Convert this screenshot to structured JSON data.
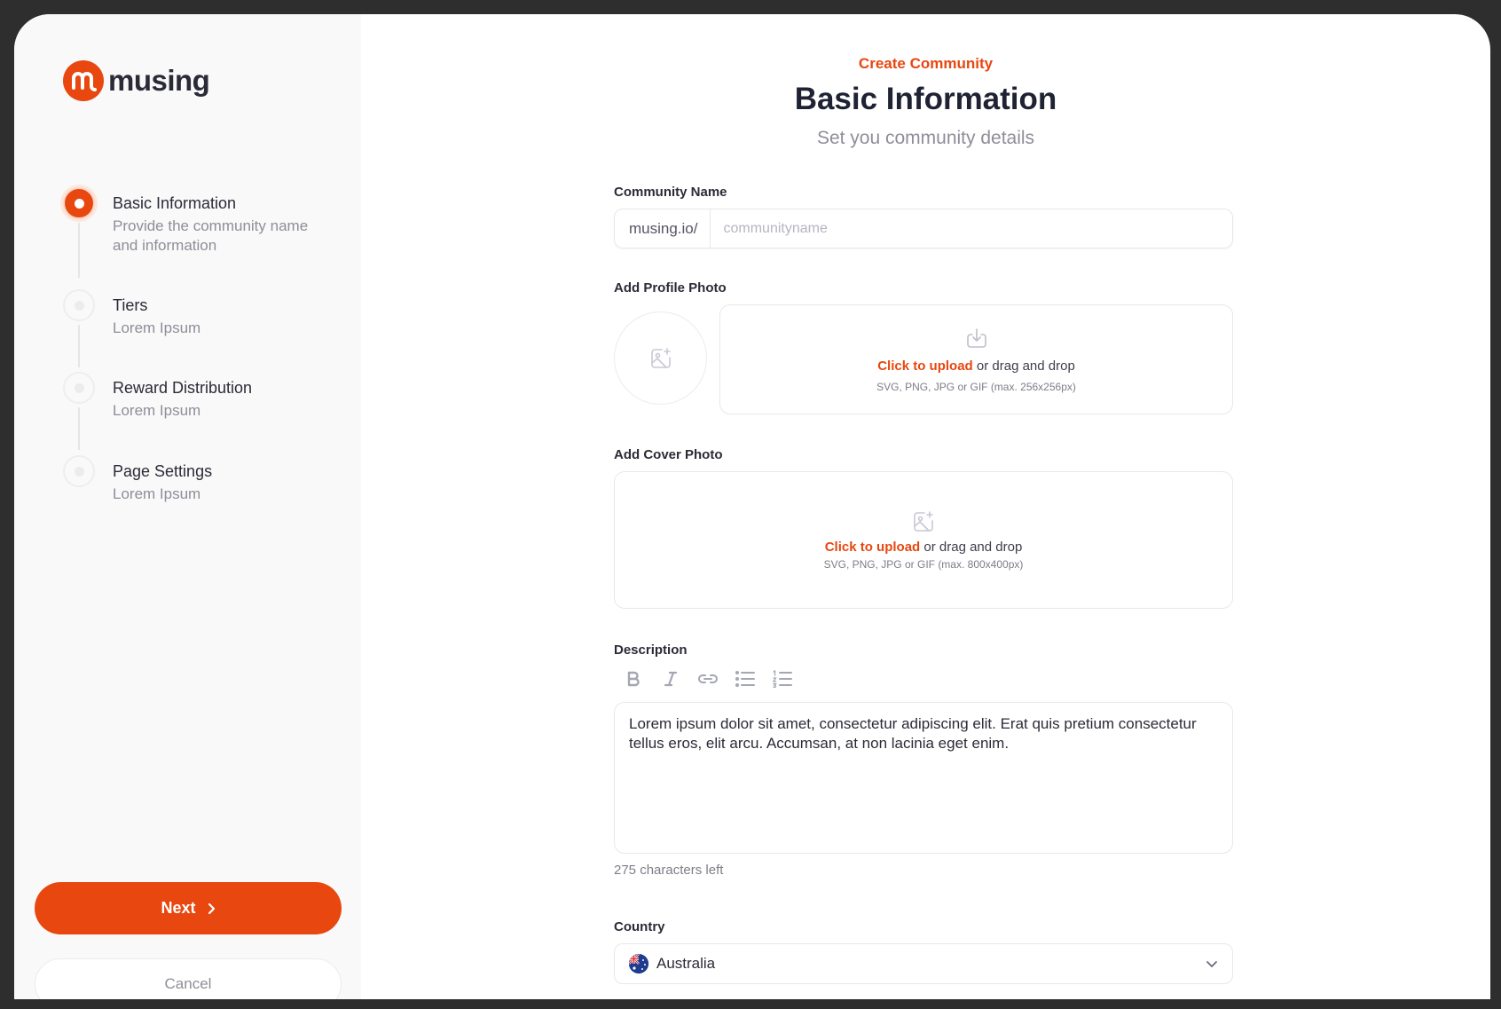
{
  "brand": {
    "name": "musing",
    "accent": "#e8470f"
  },
  "steps": [
    {
      "title": "Basic Information",
      "desc": "Provide the community name and information",
      "active": true
    },
    {
      "title": "Tiers",
      "desc": "Lorem Ipsum",
      "active": false
    },
    {
      "title": "Reward Distribution",
      "desc": "Lorem Ipsum",
      "active": false
    },
    {
      "title": "Page Settings",
      "desc": "Lorem Ipsum",
      "active": false
    }
  ],
  "actions": {
    "next_label": "Next",
    "cancel_label": "Cancel"
  },
  "header": {
    "eyebrow": "Create Community",
    "title": "Basic Information",
    "subtitle": "Set you community details"
  },
  "community_name": {
    "label": "Community Name",
    "prefix": "musing.io/",
    "placeholder": "communityname",
    "value": ""
  },
  "profile_photo": {
    "label": "Add Profile Photo",
    "upload_link": "Click to upload",
    "upload_rest": " or drag and drop",
    "hint": "SVG, PNG, JPG or GIF (max. 256x256px)"
  },
  "cover_photo": {
    "label": "Add Cover Photo",
    "upload_link": "Click to upload",
    "upload_rest": " or drag and drop",
    "hint": "SVG, PNG, JPG or GIF (max. 800x400px)"
  },
  "description": {
    "label": "Description",
    "toolbar": [
      "bold-icon",
      "italic-icon",
      "link-icon",
      "bullet-list-icon",
      "numbered-list-icon"
    ],
    "value": "Lorem ipsum dolor sit amet, consectetur adipiscing elit. Erat quis pretium consectetur tellus eros, elit arcu. Accumsan, at non lacinia eget enim.",
    "chars_left": "275 characters left"
  },
  "country": {
    "label": "Country",
    "value": "Australia",
    "flag_icon": "australia-flag-icon"
  }
}
